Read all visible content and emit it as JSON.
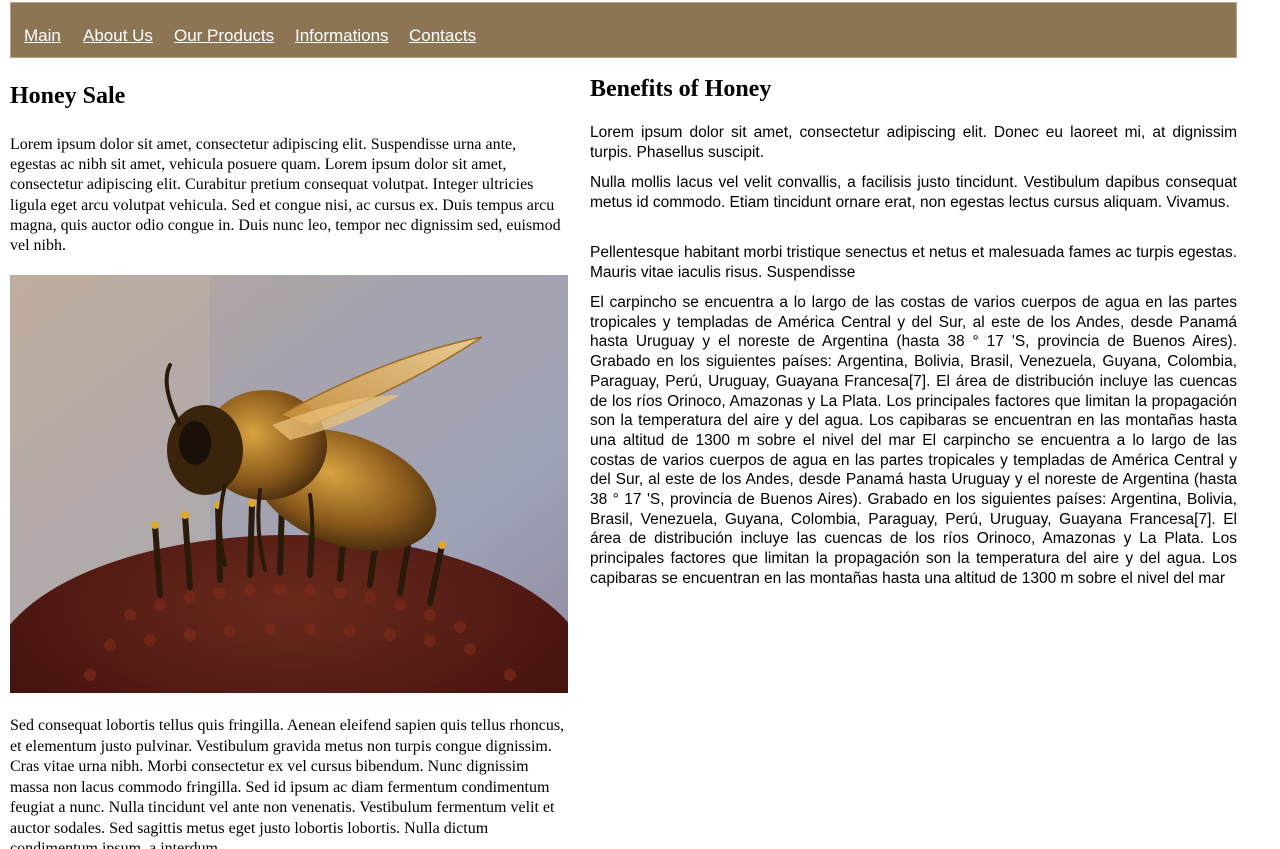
{
  "nav": {
    "items": [
      "Main",
      "About Us",
      "Our Products",
      "Informations",
      "Contacts"
    ]
  },
  "left": {
    "title": "Honey Sale",
    "intro": "Lorem ipsum dolor sit amet, consectetur adipiscing elit. Suspendisse urna ante, egestas ac nibh sit amet, vehicula posuere quam. Lorem ipsum dolor sit amet, consectetur adipiscing elit. Curabitur pretium consequat volutpat. Integer ultricies ligula eget arcu volutpat vehicula. Sed et congue nisi, ac cursus ex. Duis tempus arcu magna, quis auctor odio congue in. Duis nunc leo, tempor nec dignissim sed, euismod vel nibh.",
    "outro": "Sed consequat lobortis tellus quis fringilla. Aenean eleifend sapien quis tellus rhoncus, et elementum justo pulvinar. Vestibulum gravida metus non turpis congue dignissim. Cras vitae urna nibh. Morbi consectetur ex vel cursus bibendum. Nunc dignissim massa non lacus commodo fringilla. Sed id ipsum ac diam fermentum condimentum feugiat a nunc. Nulla tincidunt vel ante non venenatis. Vestibulum fermentum velit et auctor sodales. Sed sagittis metus eget justo lobortis lobortis. Nulla dictum condimentum ipsum, a interdum"
  },
  "right": {
    "title": "Benefits of Honey",
    "paragraphs": [
      "Lorem ipsum dolor sit amet, consectetur adipiscing elit. Donec eu laoreet mi, at dignissim turpis. Phasellus suscipit.",
      "Nulla mollis lacus vel velit convallis, a facilisis justo tincidunt. Vestibulum dapibus consequat metus id commodo. Etiam tincidunt ornare erat, non egestas lectus cursus aliquam. Vivamus.",
      "Pellentesque habitant morbi tristique senectus et netus et malesuada fames ac turpis egestas. Mauris vitae iaculis risus. Suspendisse",
      "El carpincho se encuentra a lo largo de las costas de varios cuerpos de agua en las partes tropicales y templadas de América Central y del Sur, al este de los Andes, desde Panamá hasta Uruguay y el noreste de Argentina (hasta 38 ° 17 'S, provincia de Buenos Aires). Grabado en los siguientes países: Argentina, Bolivia, Brasil, Venezuela, Guyana, Colombia, Paraguay, Perú, Uruguay, Guayana Francesa[7]. El área de distribución incluye las cuencas de los ríos Orinoco, Amazonas y La Plata. Los principales factores que limitan la propagación son la temperatura del aire y del agua. Los capibaras se encuentran en las montañas hasta una altitud de 1300 m sobre el nivel del mar El carpincho se encuentra a lo largo de las costas de varios cuerpos de agua en las partes tropicales y templadas de América Central y del Sur, al este de los Andes, desde Panamá hasta Uruguay y el noreste de Argentina (hasta 38 ° 17 'S, provincia de Buenos Aires). Grabado en los siguientes países: Argentina, Bolivia, Brasil, Venezuela, Guyana, Colombia, Paraguay, Perú, Uruguay, Guayana Francesa[7]. El área de distribución incluye las cuencas de los ríos Orinoco, Amazonas y La Plata. Los principales factores que limitan la propagación son la temperatura del aire y del agua. Los capibaras se encuentran en las montañas hasta una altitud de 1300 m sobre el nivel del mar"
    ]
  },
  "colors": {
    "nav_background": "#8b7555",
    "nav_text": "#ffffff"
  }
}
